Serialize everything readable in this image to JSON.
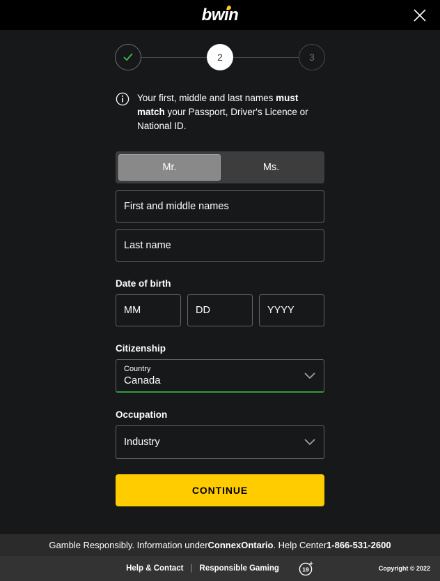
{
  "header": {
    "logo_text": "bwin",
    "close_label": "Close"
  },
  "stepper": {
    "step1_state": "completed",
    "step2_label": "2",
    "step3_label": "3"
  },
  "notice": {
    "part1": "Your first, middle and last names ",
    "bold1": "must match",
    "part2": " your Passport, Driver's Licence or National ID."
  },
  "form": {
    "title_options": [
      {
        "label": "Mr.",
        "selected": true
      },
      {
        "label": "Ms.",
        "selected": false
      }
    ],
    "title_mr": "Mr.",
    "title_ms": "Ms.",
    "first_name_placeholder": "First and middle names",
    "first_name_value": "",
    "last_name_placeholder": "Last name",
    "last_name_value": "",
    "dob_label": "Date of birth",
    "dob_month_placeholder": "MM",
    "dob_day_placeholder": "DD",
    "dob_year_placeholder": "YYYY",
    "citizenship_label": "Citizenship",
    "country_field_label": "Country",
    "country_value": "Canada",
    "country_valid_color": "#2e9e3f",
    "occupation_label": "Occupation",
    "occupation_value": "Industry",
    "continue_label": "CONTINUE",
    "continue_color": "#ffcc00"
  },
  "responsible_bar": {
    "text_part1": "Gamble Responsibly. Information under ",
    "bold1": "ConnexOntario",
    "text_part2": " . Help Center ",
    "bold2": "1-866-531-2600"
  },
  "footer": {
    "help_contact": "Help & Contact",
    "separator": "|",
    "responsible_gaming": "Responsible Gaming",
    "age_badge": "19+",
    "copyright": "Copyright © 2022"
  }
}
